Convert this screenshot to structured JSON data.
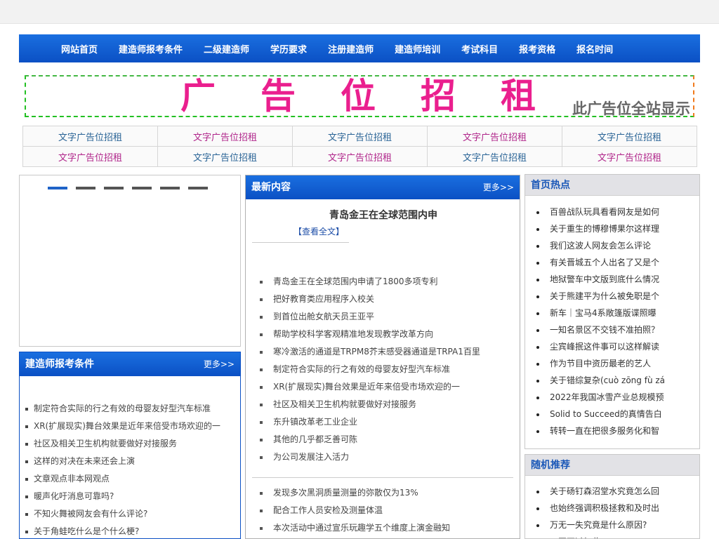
{
  "nav": [
    "网站首页",
    "建造师报考条件",
    "二级建造师",
    "学历要求",
    "注册建造师",
    "建造师培训",
    "考试科目",
    "报考资格",
    "报名时间"
  ],
  "banner": {
    "big": "广告位招租",
    "small": "此广告位全站显示"
  },
  "text_ads": [
    [
      "文字广告位招租",
      "文字广告位招租",
      "文字广告位招租",
      "文字广告位招租",
      "文字广告位招租"
    ],
    [
      "文字广告位招租",
      "文字广告位招租",
      "文字广告位招租",
      "文字广告位招租",
      "文字广告位招租"
    ]
  ],
  "requirements": {
    "title": "建造师报考条件",
    "more": "更多>>",
    "items": [
      "制定符合实际的行之有效的母婴友好型汽车标准",
      "XR(扩展现实)舞台效果是近年来倍受市场欢迎的一",
      "社区及相关卫生机构就要做好对接服务",
      "这样的对决在未来还会上演",
      "文章观点非本网观点",
      "暖声化吁消息可靠吗?",
      "不知火舞被网友会有什么评论?",
      "关于角蛙吃什么是个什么梗?"
    ]
  },
  "latest": {
    "title": "最新内容",
    "more": "更多>>",
    "featured_title": "青岛金王在全球范围内申",
    "featured_more": "【查看全文】",
    "list1": [
      "青岛金王在全球范围内申请了1800多项专利",
      "把好教育类应用程序入校关",
      "到首位出舱女航天员王亚平",
      "帮助学校科学客观精准地发现教学改革方向",
      "寒冷激活的通道是TRPM8芥末感受器通道是TRPA1百里",
      "制定符合实际的行之有效的母婴友好型汽车标准",
      "XR(扩展现实)舞台效果是近年来倍受市场欢迎的一",
      "社区及相关卫生机构就要做好对接服务",
      "东升镇改革老工业企业",
      "其他的几乎都乏善可陈",
      "为公司发展注入活力"
    ],
    "list2": [
      "发现多次黑洞质量测量的弥散仅为13%",
      "配合工作人员安检及测量体温",
      "本次活动中通过宣乐玩趣学五个维度上演金融知"
    ]
  },
  "hot": {
    "title": "首页热点",
    "items": [
      "百兽战队玩具看看网友是如何",
      "关于重生的博穆博果尔这样理",
      "我们这波人网友会怎么评论",
      "有关晋城五个人出名了又是个",
      "地狱警车中文版到底什么情况",
      "关于熊建平为什么被免职是个",
      "新车｜宝马4系敞篷版谍照曝",
      "一知名景区不交钱不准拍照？",
      "尘宾峰抿这件事可以这样解读",
      "作为节目中资历最老的艺人",
      "关于错综复杂(cuò zōng fù zá",
      "2022年我国冰雪产业总规模预",
      "Solid to Succeed的真情告白",
      "转转一直在把很多服务化和智"
    ]
  },
  "random": {
    "title": "随机推荐",
    "items": [
      "关于砀钉森沼堂水究竟怎么回",
      "也始终强调积极拯救和及时出",
      "万无一失究竟是什么原因?",
      "三国不过如此..."
    ]
  }
}
